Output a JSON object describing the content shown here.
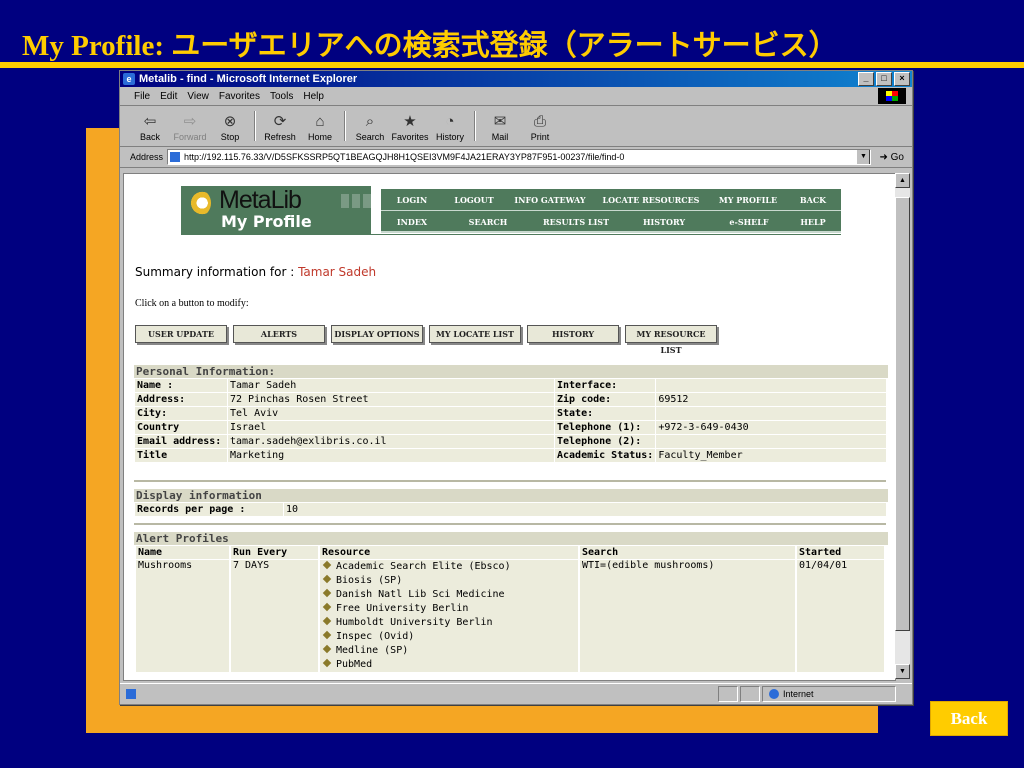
{
  "slide": {
    "title": "My Profile: ユーザエリアへの検索式登録（アラートサービス）",
    "back_label": "Back"
  },
  "window": {
    "title": "Metalib - find - Microsoft Internet Explorer",
    "menu": [
      "File",
      "Edit",
      "View",
      "Favorites",
      "Tools",
      "Help"
    ],
    "toolbar": [
      {
        "label": "Back",
        "icon": "back-arrow-icon",
        "glyph": "⇦",
        "enabled": true
      },
      {
        "label": "Forward",
        "icon": "forward-arrow-icon",
        "glyph": "⇨",
        "enabled": false
      },
      {
        "label": "Stop",
        "icon": "stop-icon",
        "glyph": "⊗",
        "enabled": true
      },
      {
        "label": "Refresh",
        "icon": "refresh-icon",
        "glyph": "⟳",
        "enabled": true
      },
      {
        "label": "Home",
        "icon": "home-icon",
        "glyph": "⌂",
        "enabled": true
      },
      {
        "label": "Search",
        "icon": "search-icon",
        "glyph": "⌕",
        "enabled": true
      },
      {
        "label": "Favorites",
        "icon": "favorites-icon",
        "glyph": "★",
        "enabled": true
      },
      {
        "label": "History",
        "icon": "history-icon",
        "glyph": "◔",
        "enabled": true
      },
      {
        "label": "Mail",
        "icon": "mail-icon",
        "glyph": "✉",
        "enabled": true
      },
      {
        "label": "Print",
        "icon": "print-icon",
        "glyph": "⎙",
        "enabled": true
      }
    ],
    "address_label": "Address",
    "address": "http://192.115.76.33/V/D5SFKSSRP5QT1BEAGQJH8H1QSEI3VM9F4JA21ERAY3YP87F951-00237/file/find-0",
    "go_label": "Go",
    "status_zone": "Internet"
  },
  "metalib": {
    "logo_name": "MetaLib",
    "logo_sub": "My Profile",
    "nav_row1": [
      "LOGIN",
      "LOGOUT",
      "INFO GATEWAY",
      "LOCATE RESOURCES",
      "MY PROFILE",
      "BACK"
    ],
    "nav_row2": [
      "INDEX",
      "SEARCH",
      "RESULTS LIST",
      "HISTORY",
      "e-SHELF",
      "HELP"
    ]
  },
  "profile": {
    "summary_prefix": "Summary information for :",
    "user_name": "Tamar Sadeh",
    "hint": "Click on a button to modify:",
    "buttons": [
      "USER UPDATE",
      "ALERTS",
      "DISPLAY OPTIONS",
      "MY LOCATE LIST",
      "HISTORY",
      "MY RESOURCE LIST"
    ],
    "personal_heading": "Personal Information:",
    "personal": [
      [
        "Name :",
        "Tamar Sadeh",
        "Interface:",
        ""
      ],
      [
        "Address:",
        "72 Pinchas Rosen Street",
        "Zip code:",
        "69512"
      ],
      [
        "City:",
        "Tel Aviv",
        "State:",
        ""
      ],
      [
        "Country",
        "Israel",
        "Telephone (1):",
        "+972-3-649-0430"
      ],
      [
        "Email address:",
        "tamar.sadeh@exlibris.co.il",
        "Telephone (2):",
        ""
      ],
      [
        "Title",
        "Marketing",
        "Academic Status:",
        "Faculty_Member"
      ]
    ],
    "display_heading": "Display information",
    "records_label": "Records per page :",
    "records_value": "10",
    "alerts_heading": "Alert Profiles",
    "alert_columns": [
      "Name",
      "Run Every",
      "Resource",
      "Search",
      "Started"
    ],
    "alert": {
      "name": "Mushrooms",
      "run_every": "7 DAYS",
      "resources": [
        "Academic Search Elite (Ebsco)",
        "Biosis (SP)",
        "Danish Natl Lib Sci Medicine",
        "Free University Berlin",
        "Humboldt University Berlin",
        "Inspec (Ovid)",
        "Medline (SP)",
        "PubMed"
      ],
      "search": "WTI=(edible mushrooms)",
      "started": "01/04/01"
    }
  }
}
